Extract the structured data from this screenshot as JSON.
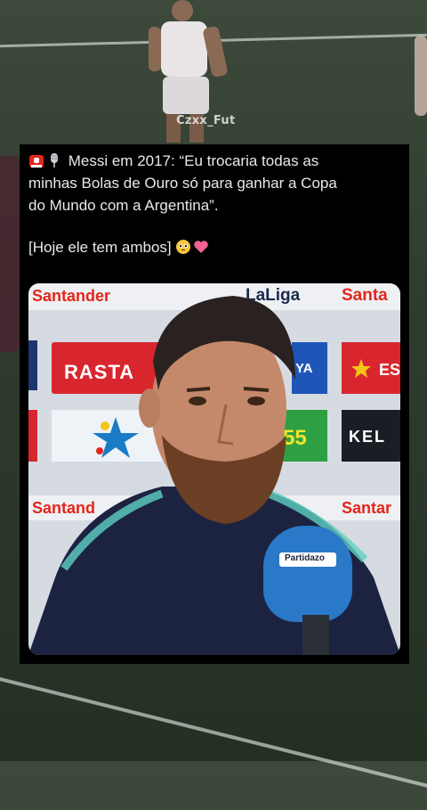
{
  "background": {
    "watermark": "Czxx_Fut"
  },
  "tweet": {
    "emojis": [
      "rotating-light-icon",
      "microphone-icon"
    ],
    "line1": "Messi em 2017: “Eu trocaria todas as",
    "line2": "minhas Bolas de Ouro só para ganhar a Copa",
    "line3": "do Mundo com a Argentina”.",
    "line4": "[Hoje ele tem ambos]",
    "trailing_emojis": [
      "pleading-face-icon",
      "pink-heart-icon"
    ]
  },
  "media": {
    "sponsors_top": [
      "Santander",
      "LaLiga",
      "Santa"
    ],
    "sponsors_mid": [
      "RASTA",
      "YA",
      "ES"
    ],
    "sponsors_low": [
      "55",
      "KEL"
    ],
    "sponsors_bottom": [
      "Santand",
      "Santar"
    ],
    "mic_label": "Partidazo",
    "colors": {
      "santander_red": "#e3261b",
      "jersey": "#1c2341",
      "mic": "#2a78c8"
    }
  }
}
